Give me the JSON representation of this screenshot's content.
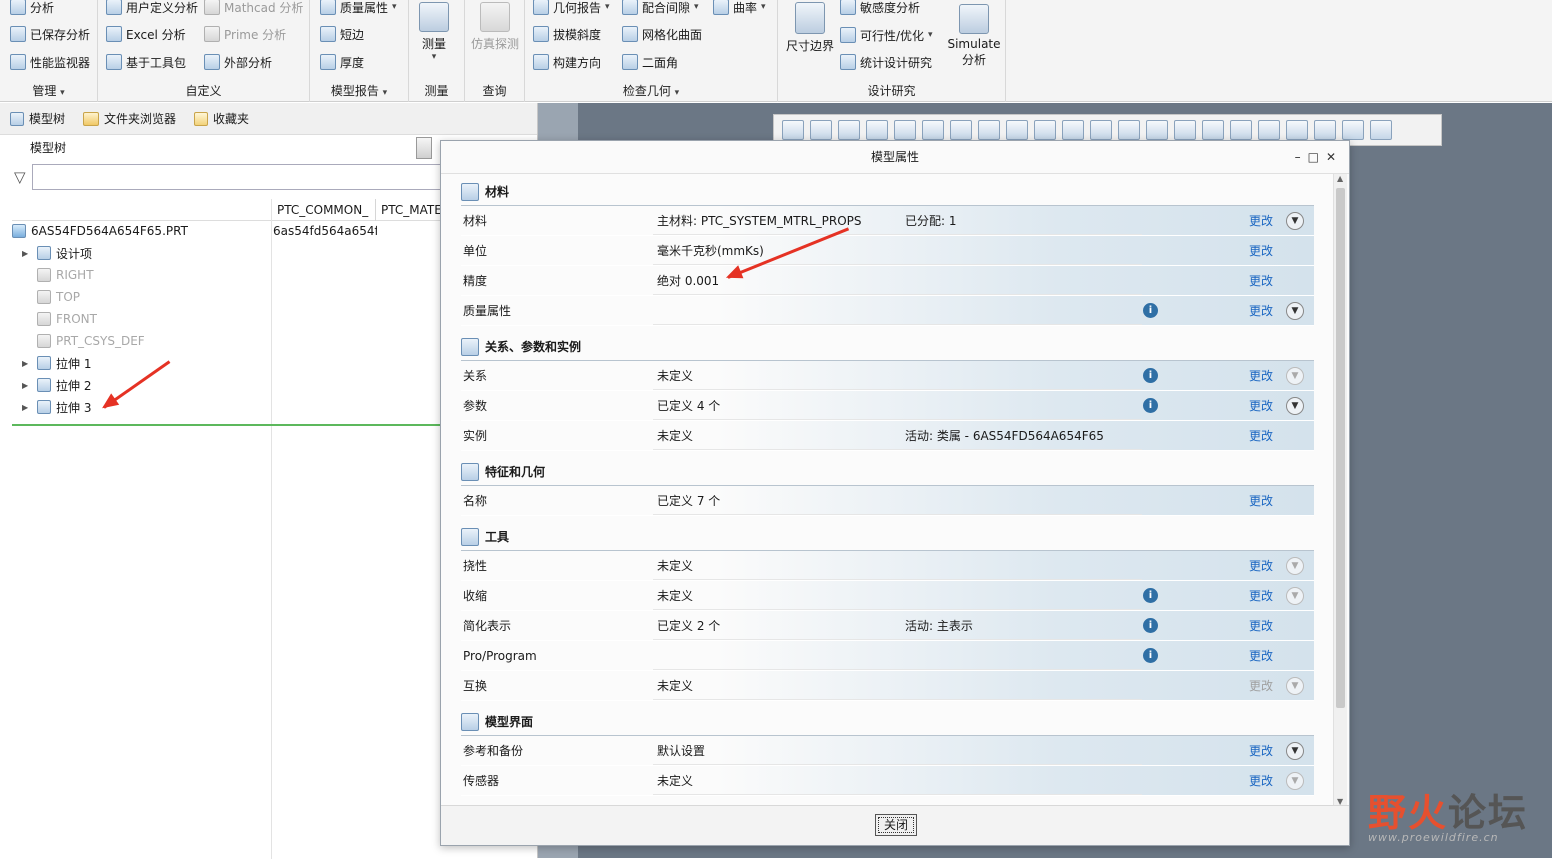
{
  "ribbon": {
    "manage": {
      "items": [
        "分析",
        "已保存分析",
        "性能监视器"
      ],
      "label": "管理"
    },
    "custom": {
      "items": [
        "用户定义分析",
        "Excel 分析",
        "基于工具包",
        "Mathcad 分析",
        "Prime 分析",
        "外部分析"
      ],
      "label": "自定义"
    },
    "model_report": {
      "items": [
        "质量属性",
        "短边",
        "厚度"
      ],
      "label": "模型报告"
    },
    "measure": {
      "button": "测量",
      "label": "测量"
    },
    "query": {
      "button": "仿真探测",
      "label": "查询"
    },
    "inspect": {
      "items": [
        "几何报告",
        "拔模斜度",
        "构建方向",
        "配合间隙",
        "网格化曲面",
        "二面角",
        "曲率"
      ],
      "label": "检查几何"
    },
    "design_study": {
      "dim_button": "尺寸边界",
      "items": [
        "敏感度分析",
        "可行性/优化",
        "统计设计研究"
      ],
      "simulate": "Simulate 分析",
      "label": "设计研究"
    }
  },
  "left_panel": {
    "tabs": [
      "模型树",
      "文件夹浏览器",
      "收藏夹"
    ],
    "tree_header": "模型树",
    "columns": [
      "PTC_COMMON_",
      "PTC_MATE"
    ],
    "root": {
      "name": "6AS54FD564A654F65.PRT",
      "col1": "6as54fd564a654f"
    },
    "nodes": [
      {
        "label": "设计项",
        "expandable": true,
        "disabled": false
      },
      {
        "label": "RIGHT",
        "expandable": false,
        "disabled": true
      },
      {
        "label": "TOP",
        "expandable": false,
        "disabled": true
      },
      {
        "label": "FRONT",
        "expandable": false,
        "disabled": true
      },
      {
        "label": "PRT_CSYS_DEF",
        "expandable": false,
        "disabled": true
      },
      {
        "label": "拉伸 1",
        "expandable": true,
        "disabled": false
      },
      {
        "label": "拉伸 2",
        "expandable": true,
        "disabled": false
      },
      {
        "label": "拉伸 3",
        "expandable": true,
        "disabled": false
      }
    ]
  },
  "dialog": {
    "title": "模型属性",
    "change_label": "更改",
    "close_label": "关闭",
    "sections": [
      {
        "title": "材料",
        "rows": [
          {
            "key": "材料",
            "value": "主材料: PTC_SYSTEM_MTRL_PROPS",
            "extra": "已分配: 1",
            "help": false,
            "change_enabled": true,
            "expand": "on"
          },
          {
            "key": "单位",
            "value": "毫米千克秒(mmKs)",
            "extra": "",
            "help": false,
            "change_enabled": true,
            "expand": "none"
          },
          {
            "key": "精度",
            "value": "绝对 0.001",
            "extra": "",
            "help": false,
            "change_enabled": true,
            "expand": "none"
          },
          {
            "key": "质量属性",
            "value": "",
            "extra": "",
            "help": true,
            "change_enabled": true,
            "expand": "on"
          }
        ]
      },
      {
        "title": "关系、参数和实例",
        "rows": [
          {
            "key": "关系",
            "value": "未定义",
            "extra": "",
            "help": true,
            "change_enabled": true,
            "expand": "dis"
          },
          {
            "key": "参数",
            "value": "已定义 4 个",
            "extra": "",
            "help": true,
            "change_enabled": true,
            "expand": "on"
          },
          {
            "key": "实例",
            "value": "未定义",
            "extra": "活动: 类属 - 6AS54FD564A654F65",
            "help": false,
            "change_enabled": true,
            "expand": "none"
          }
        ]
      },
      {
        "title": "特征和几何",
        "rows": [
          {
            "key": "名称",
            "value": "已定义 7 个",
            "extra": "",
            "help": false,
            "change_enabled": true,
            "expand": "none"
          }
        ]
      },
      {
        "title": "工具",
        "rows": [
          {
            "key": "挠性",
            "value": "未定义",
            "extra": "",
            "help": false,
            "change_enabled": true,
            "expand": "dis"
          },
          {
            "key": "收缩",
            "value": "未定义",
            "extra": "",
            "help": true,
            "change_enabled": true,
            "expand": "dis"
          },
          {
            "key": "简化表示",
            "value": "已定义 2 个",
            "extra": "活动: 主表示",
            "help": true,
            "change_enabled": true,
            "expand": "none"
          },
          {
            "key": "Pro/Program",
            "value": "",
            "extra": "",
            "help": true,
            "change_enabled": true,
            "expand": "none"
          },
          {
            "key": "互换",
            "value": "未定义",
            "extra": "",
            "help": false,
            "change_enabled": false,
            "expand": "dis"
          }
        ]
      },
      {
        "title": "模型界面",
        "rows": [
          {
            "key": "参考和备份",
            "value": "默认设置",
            "extra": "",
            "help": false,
            "change_enabled": true,
            "expand": "on"
          },
          {
            "key": "传感器",
            "value": "未定义",
            "extra": "",
            "help": false,
            "change_enabled": true,
            "expand": "dis"
          }
        ]
      }
    ]
  },
  "watermark": {
    "main_a": "野火",
    "main_b": "论坛",
    "sub": "www.proewildfire.cn"
  },
  "colors": {
    "annotation_arrow": "#e53224",
    "link": "#1a66c2",
    "help_icon": "#2f6fa5",
    "tree_highlight": "#5cb85c"
  }
}
